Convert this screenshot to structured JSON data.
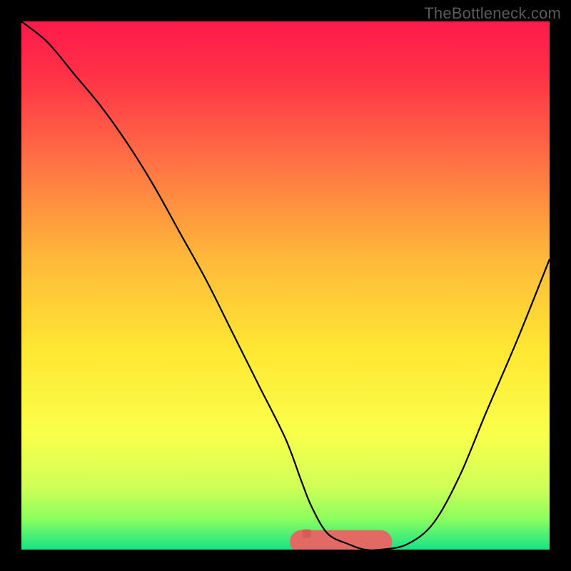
{
  "watermark": "TheBottleneck.com",
  "chart_data": {
    "type": "line",
    "title": "",
    "xlabel": "",
    "ylabel": "",
    "xlim": [
      0,
      100
    ],
    "ylim": [
      0,
      100
    ],
    "grid": false,
    "legend": false,
    "series": [
      {
        "name": "bottleneck-curve",
        "x": [
          0,
          5,
          10,
          15,
          20,
          25,
          30,
          35,
          40,
          45,
          50,
          53,
          55,
          58,
          62,
          65,
          68,
          73,
          78,
          83,
          88,
          94,
          100
        ],
        "values": [
          100,
          96,
          90,
          84,
          77,
          69,
          60,
          51,
          41,
          31,
          21,
          13,
          8,
          3,
          1,
          0,
          0,
          1,
          5,
          14,
          26,
          40,
          55
        ]
      }
    ],
    "optimal_zone": {
      "x_start": 53,
      "x_end": 68,
      "y_min": 0,
      "y_max": 3
    },
    "markers": [
      {
        "name": "optimal-marker",
        "x": 54,
        "y": 3
      }
    ],
    "gradient_stops": [
      {
        "offset": 0.0,
        "color": "#ff1a4b"
      },
      {
        "offset": 0.1,
        "color": "#ff3047"
      },
      {
        "offset": 0.25,
        "color": "#ff6b45"
      },
      {
        "offset": 0.45,
        "color": "#ffb93a"
      },
      {
        "offset": 0.62,
        "color": "#ffe733"
      },
      {
        "offset": 0.78,
        "color": "#faff4a"
      },
      {
        "offset": 0.88,
        "color": "#d1ff57"
      },
      {
        "offset": 0.94,
        "color": "#8eff5e"
      },
      {
        "offset": 1.0,
        "color": "#17e387"
      }
    ],
    "curve_color": "#000000",
    "optimal_zone_color": "#e16a65",
    "marker_color": "#d95a56"
  }
}
